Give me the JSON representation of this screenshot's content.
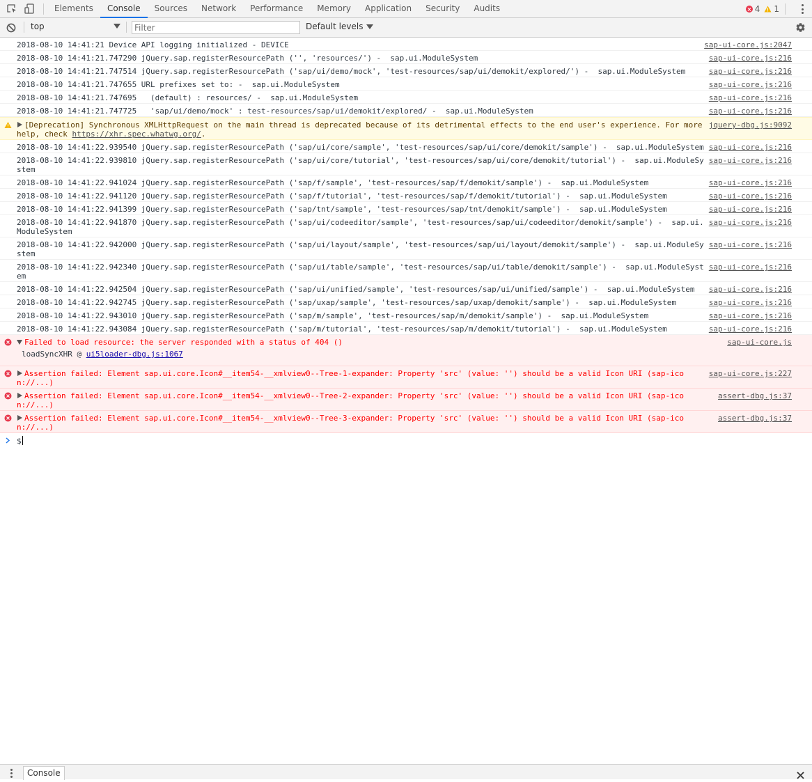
{
  "tabs": [
    "Elements",
    "Console",
    "Sources",
    "Network",
    "Performance",
    "Memory",
    "Application",
    "Security",
    "Audits"
  ],
  "active_tab": "Console",
  "counters": {
    "errors": "4",
    "warnings": "1"
  },
  "toolbar": {
    "context": "top",
    "filter_placeholder": "Filter",
    "levels": "Default levels"
  },
  "messages": [
    {
      "level": "info",
      "text": "2018-08-10 14:41:21 Device API logging initialized - DEVICE",
      "source": "sap-ui-core.js:2047"
    },
    {
      "level": "info",
      "text": "2018-08-10 14:41:21.747290 jQuery.sap.registerResourcePath ('', 'resources/') -  sap.ui.ModuleSystem",
      "source": "sap-ui-core.js:216"
    },
    {
      "level": "info",
      "text": "2018-08-10 14:41:21.747514 jQuery.sap.registerResourcePath ('sap/ui/demo/mock', 'test-resources/sap/ui/demokit/explored/') -  sap.ui.ModuleSystem",
      "source": "sap-ui-core.js:216"
    },
    {
      "level": "info",
      "text": "2018-08-10 14:41:21.747655 URL prefixes set to: -  sap.ui.ModuleSystem",
      "source": "sap-ui-core.js:216"
    },
    {
      "level": "info",
      "text": "2018-08-10 14:41:21.747695   (default) : resources/ -  sap.ui.ModuleSystem",
      "source": "sap-ui-core.js:216"
    },
    {
      "level": "info",
      "text": "2018-08-10 14:41:21.747725   'sap/ui/demo/mock' : test-resources/sap/ui/demokit/explored/ -  sap.ui.ModuleSystem",
      "source": "sap-ui-core.js:216"
    },
    {
      "level": "warn",
      "text": "[Deprecation] Synchronous XMLHttpRequest on the main thread is deprecated because of its detrimental effects to the end user's experience. For more help, check ",
      "link": "https://xhr.spec.whatwg.org/",
      "suffix": ".",
      "source": "jquery-dbg.js:9092"
    },
    {
      "level": "info",
      "text": "2018-08-10 14:41:22.939540 jQuery.sap.registerResourcePath ('sap/ui/core/sample', 'test-resources/sap/ui/core/demokit/sample') -  sap.ui.ModuleSystem",
      "source": "sap-ui-core.js:216"
    },
    {
      "level": "info",
      "text": "2018-08-10 14:41:22.939810 jQuery.sap.registerResourcePath ('sap/ui/core/tutorial', 'test-resources/sap/ui/core/demokit/tutorial') -  sap.ui.ModuleSystem",
      "source": "sap-ui-core.js:216"
    },
    {
      "level": "info",
      "text": "2018-08-10 14:41:22.941024 jQuery.sap.registerResourcePath ('sap/f/sample', 'test-resources/sap/f/demokit/sample') -  sap.ui.ModuleSystem",
      "source": "sap-ui-core.js:216"
    },
    {
      "level": "info",
      "text": "2018-08-10 14:41:22.941120 jQuery.sap.registerResourcePath ('sap/f/tutorial', 'test-resources/sap/f/demokit/tutorial') -  sap.ui.ModuleSystem",
      "source": "sap-ui-core.js:216"
    },
    {
      "level": "info",
      "text": "2018-08-10 14:41:22.941399 jQuery.sap.registerResourcePath ('sap/tnt/sample', 'test-resources/sap/tnt/demokit/sample') -  sap.ui.ModuleSystem",
      "source": "sap-ui-core.js:216"
    },
    {
      "level": "info",
      "text": "2018-08-10 14:41:22.941870 jQuery.sap.registerResourcePath ('sap/ui/codeeditor/sample', 'test-resources/sap/ui/codeeditor/demokit/sample') -  sap.ui.ModuleSystem",
      "source": "sap-ui-core.js:216"
    },
    {
      "level": "info",
      "text": "2018-08-10 14:41:22.942000 jQuery.sap.registerResourcePath ('sap/ui/layout/sample', 'test-resources/sap/ui/layout/demokit/sample') -  sap.ui.ModuleSystem",
      "source": "sap-ui-core.js:216"
    },
    {
      "level": "info",
      "text": "2018-08-10 14:41:22.942340 jQuery.sap.registerResourcePath ('sap/ui/table/sample', 'test-resources/sap/ui/table/demokit/sample') -  sap.ui.ModuleSystem",
      "source": "sap-ui-core.js:216"
    },
    {
      "level": "info",
      "text": "2018-08-10 14:41:22.942504 jQuery.sap.registerResourcePath ('sap/ui/unified/sample', 'test-resources/sap/ui/unified/sample') -  sap.ui.ModuleSystem",
      "source": "sap-ui-core.js:216"
    },
    {
      "level": "info",
      "text": "2018-08-10 14:41:22.942745 jQuery.sap.registerResourcePath ('sap/uxap/sample', 'test-resources/sap/uxap/demokit/sample') -  sap.ui.ModuleSystem",
      "source": "sap-ui-core.js:216"
    },
    {
      "level": "info",
      "text": "2018-08-10 14:41:22.943010 jQuery.sap.registerResourcePath ('sap/m/sample', 'test-resources/sap/m/demokit/sample') -  sap.ui.ModuleSystem",
      "source": "sap-ui-core.js:216"
    },
    {
      "level": "info",
      "text": "2018-08-10 14:41:22.943084 jQuery.sap.registerResourcePath ('sap/m/tutorial', 'test-resources/sap/m/demokit/tutorial') -  sap.ui.ModuleSystem",
      "source": "sap-ui-core.js:216"
    },
    {
      "level": "error",
      "expanded": true,
      "text": "Failed to load resource: the server responded with a status of 404 ()",
      "source": "sap-ui-core.js",
      "stack": {
        "fn": "loadSyncXHR",
        "at": "@",
        "link": "ui5loader-dbg.js:1067"
      }
    },
    {
      "level": "error",
      "expanded": false,
      "text": "Assertion failed: Element sap.ui.core.Icon#__item54-__xmlview0--Tree-1-expander: Property 'src' (value: '') should be a valid Icon URI (sap-icon://...)",
      "source": "sap-ui-core.js:227"
    },
    {
      "level": "error",
      "expanded": false,
      "text": "Assertion failed: Element sap.ui.core.Icon#__item54-__xmlview0--Tree-2-expander: Property 'src' (value: '') should be a valid Icon URI (sap-icon://...)",
      "source": "assert-dbg.js:37"
    },
    {
      "level": "error",
      "expanded": false,
      "text": "Assertion failed: Element sap.ui.core.Icon#__item54-__xmlview0--Tree-3-expander: Property 'src' (value: '') should be a valid Icon URI (sap-icon://...)",
      "source": "assert-dbg.js:37"
    }
  ],
  "prompt": "$",
  "drawer": {
    "tab": "Console"
  },
  "colors": {
    "accent": "#1a73e8",
    "error": "#ff0000",
    "error_bg": "#fff0f0",
    "warn_bg": "#fffbe5"
  }
}
